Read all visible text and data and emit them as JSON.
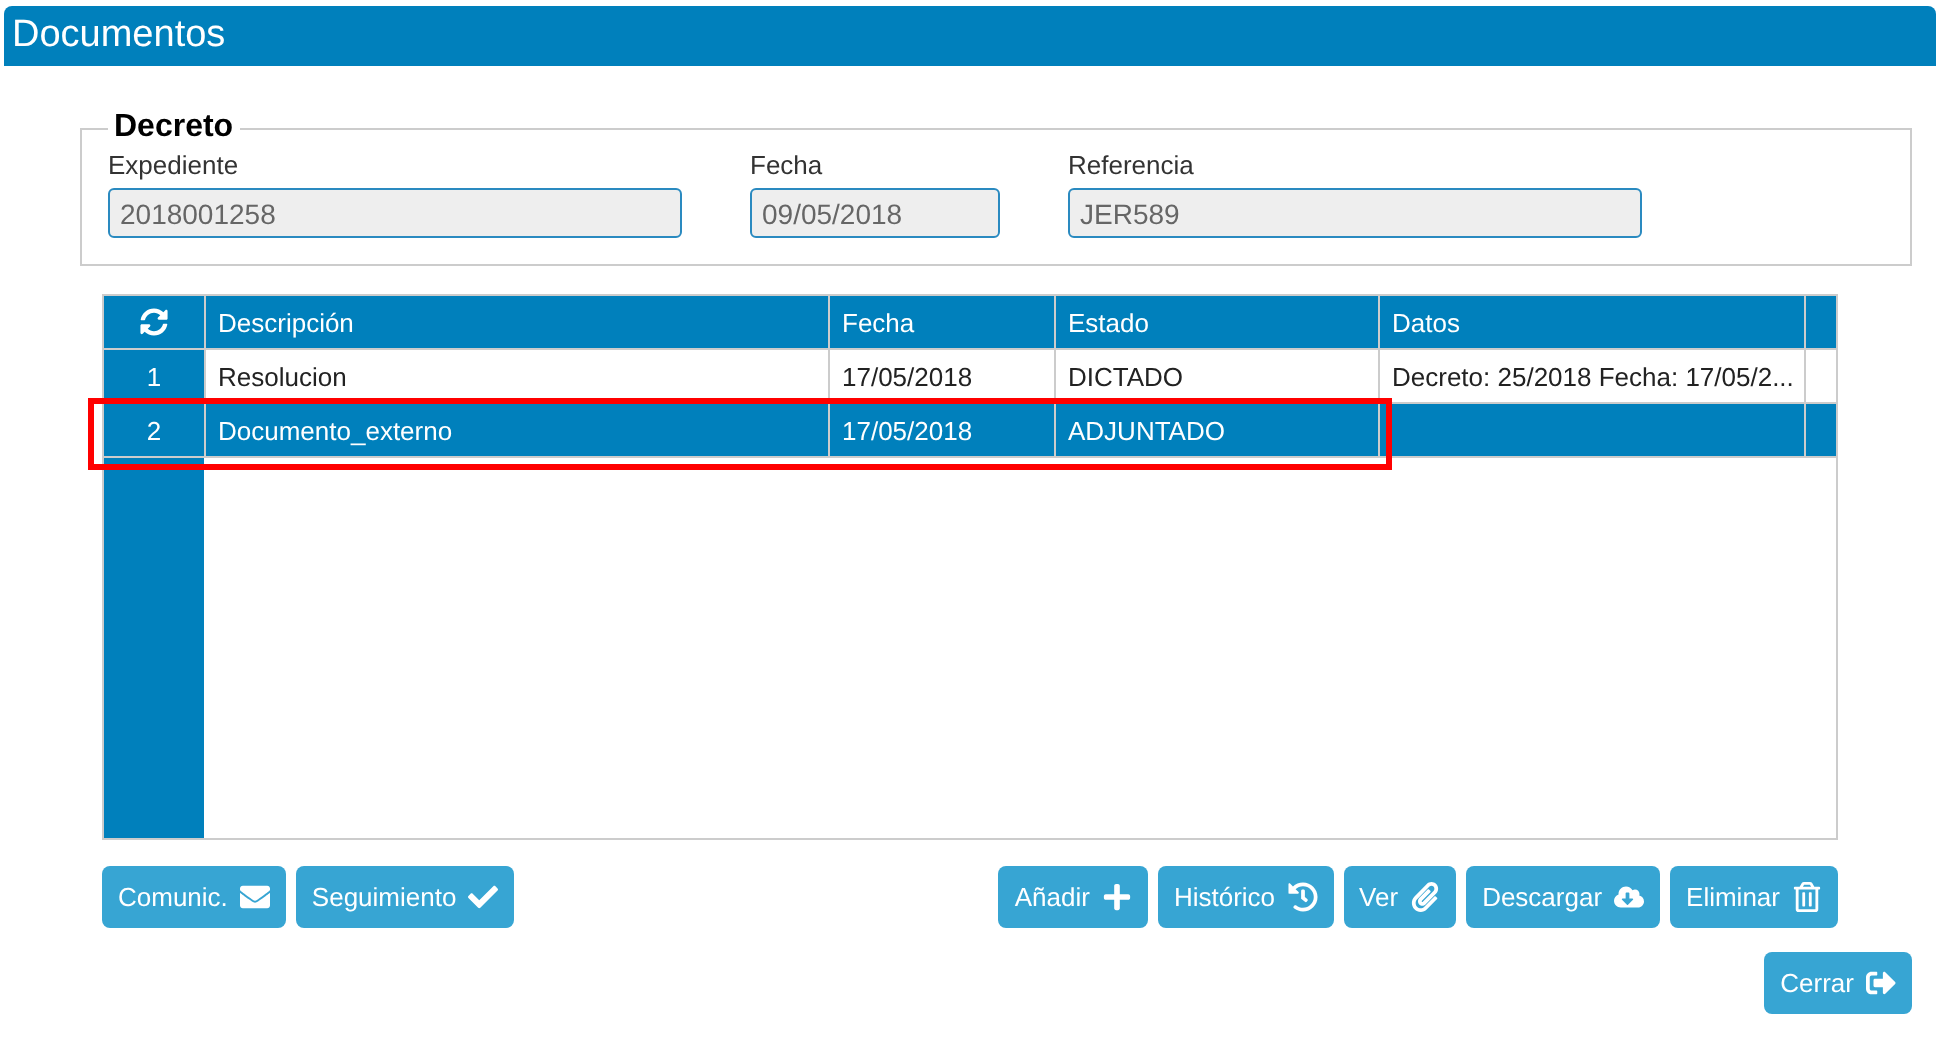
{
  "window": {
    "title": "Documentos"
  },
  "decreto": {
    "legend": "Decreto",
    "fields": [
      {
        "label": "Expediente",
        "value": "2018001258"
      },
      {
        "label": "Fecha",
        "value": "09/05/2018"
      },
      {
        "label": "Referencia",
        "value": "JER589"
      }
    ]
  },
  "table": {
    "columns": [
      "Descripción",
      "Fecha",
      "Estado",
      "Datos"
    ],
    "rows": [
      {
        "number": "1",
        "cells": [
          "Resolucion",
          "17/05/2018",
          "DICTADO",
          "Decreto: 25/2018 Fecha: 17/05/2..."
        ],
        "selected": false,
        "highlighted": false
      },
      {
        "number": "2",
        "cells": [
          "Documento_externo",
          "17/05/2018",
          "ADJUNTADO",
          ""
        ],
        "selected": true,
        "highlighted": true
      }
    ]
  },
  "left_buttons": [
    {
      "label": "Comunic.",
      "kind": "envelope"
    },
    {
      "label": "Seguimiento",
      "kind": "check"
    }
  ],
  "right_buttons": [
    {
      "label": "Añadir",
      "kind": "plus"
    },
    {
      "label": "Histórico",
      "kind": "history"
    },
    {
      "label": "Ver",
      "kind": "paperclip"
    },
    {
      "label": "Descargar",
      "kind": "download"
    },
    {
      "label": "Eliminar",
      "kind": "trash"
    }
  ],
  "close_button": {
    "label": "Cerrar",
    "kind": "exit"
  }
}
